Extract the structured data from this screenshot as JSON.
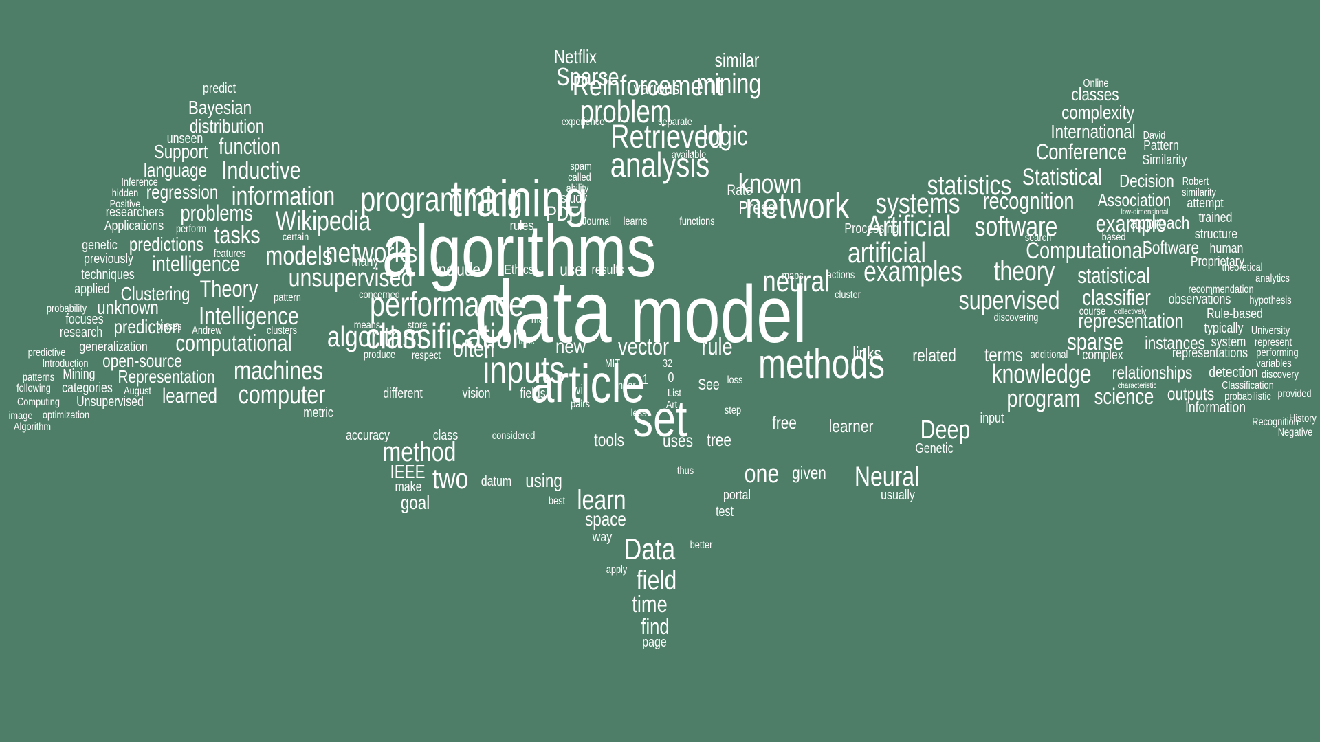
{
  "words": [
    "algorithms",
    "data",
    "model",
    "training",
    "article",
    "set",
    "network",
    "methods",
    "classification",
    "performance",
    "inputs",
    "programming",
    "analysis",
    "Retrieved",
    "problem",
    "Reinforcement",
    "neural",
    "known",
    "networks",
    "Artificial",
    "software",
    "artificial",
    "examples",
    "theory",
    "systems",
    "statistics",
    "Wikipedia",
    "models",
    "unsupervised",
    "algorithm",
    "Data",
    "learn",
    "field",
    "Deep",
    "Neural",
    "method",
    "two",
    "computer",
    "machines",
    "supervised",
    "knowledge",
    "Statistical",
    "recognition",
    "example",
    "Computational",
    "representation",
    "sparse",
    "program",
    "Sparse",
    "mining",
    "logic",
    "vector",
    "rule",
    "one",
    "time",
    "find",
    "classifier",
    "statistical",
    "science",
    "Conference",
    "International",
    "complexity",
    "classes",
    "information",
    "Inductive",
    "function",
    "Intelligence",
    "computational",
    "Theory",
    "tasks",
    "problems",
    "intelligence",
    "Bayesian",
    "distribution",
    "Support",
    "language",
    "regression",
    "Clustering",
    "unknown",
    "prediction",
    "predictions",
    "Representation",
    "learned",
    "open-source",
    "similar",
    "Netflix",
    "various",
    "PDF",
    "Press",
    "Rate",
    "often",
    "new",
    "related",
    "links",
    "terms",
    "relationships",
    "instances",
    "detection",
    "outputs",
    "Information",
    "Decision",
    "Association",
    "approach",
    "Software",
    "Similarity",
    "Pattern",
    "observations",
    "representations",
    "Rule-based",
    "Proprietary",
    "trained",
    "attempt",
    "structure",
    "human",
    "typically",
    "system",
    "include",
    "Ethics",
    "use",
    "results",
    "rules",
    "Processing",
    "goal",
    "using",
    "datum",
    "make",
    "IEEE",
    "accuracy",
    "class",
    "considered",
    "tools",
    "uses",
    "tree",
    "given",
    "free",
    "learner",
    "Genetic",
    "usually",
    "input",
    "portal",
    "test",
    "better",
    "space",
    "way",
    "apply",
    "page",
    "best",
    "thus",
    "predict",
    "unseen",
    "Inference",
    "hidden",
    "Positive",
    "researchers",
    "Applications",
    "genetic",
    "previously",
    "techniques",
    "applied",
    "probability",
    "focuses",
    "research",
    "predictive",
    "Introduction",
    "patterns",
    "following",
    "Computing",
    "image",
    "Algorithm",
    "Mining",
    "categories",
    "Unsupervised",
    "generalization",
    "optimization",
    "August",
    "Andrew",
    "biases",
    "perform",
    "features",
    "certain",
    "pattern",
    "clusters",
    "produce",
    "respect",
    "means",
    "store",
    "concerned",
    "many",
    "vision",
    "fields",
    "different",
    "metric",
    "will",
    "pairs",
    "Art",
    "List",
    "MIT",
    "linear",
    "less",
    "loss",
    "step",
    "See",
    "32",
    "0",
    "1",
    "task",
    "may",
    "maps",
    "actions",
    "cluster",
    "discovering",
    "additional",
    "search",
    "based",
    "course",
    "complex",
    "collectively",
    "characteristic",
    "Classification",
    "probabilistic",
    "provided",
    "History",
    "Negative",
    "Recognition",
    "University",
    "represent",
    "performing",
    "variables",
    "discovery",
    "hypothesis",
    "analytics",
    "theoretical",
    "recommendation",
    "low-dimensional",
    "similarity",
    "Robert",
    "David",
    "Online",
    "experience",
    "separate",
    "available",
    "spam",
    "called",
    "ability",
    "study",
    "Journal",
    "learns",
    "functions"
  ]
}
